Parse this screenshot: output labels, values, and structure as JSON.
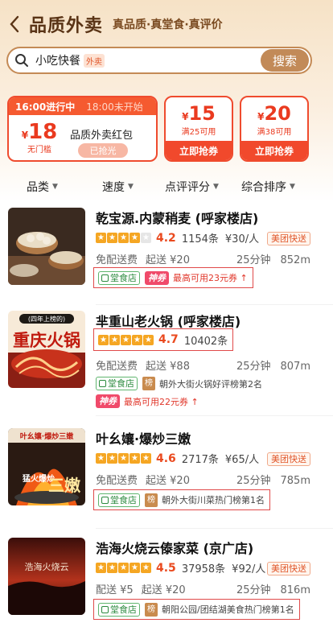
{
  "header": {
    "title": "品质外卖",
    "subtitle": "真品质·真堂食·真评价"
  },
  "search": {
    "query": "小吃快餐",
    "tag": "外卖",
    "button": "搜索"
  },
  "coupons": {
    "main": {
      "now_label": "16:00进行中",
      "next_label": "18:00未开始",
      "currency": "¥",
      "amount": "18",
      "condition": "无门槛",
      "name": "品质外卖红包",
      "button": "已抢光"
    },
    "small": [
      {
        "currency": "¥",
        "amount": "15",
        "condition": "满25可用",
        "button": "立即抢券"
      },
      {
        "currency": "¥",
        "amount": "20",
        "condition": "满38可用",
        "button": "立即抢券"
      }
    ]
  },
  "filters": [
    "品类",
    "速度",
    "点评评分",
    "综合排序"
  ],
  "shops": [
    {
      "name": "乾宝源.内蒙稍麦 (呼家楼店)",
      "stars": 4,
      "rating": "4.2",
      "reviews": "1154条",
      "price": "¥30/人",
      "badge": "美团快送",
      "delivery_fee": "免配送费",
      "min_order": "起送 ¥20",
      "time": "25分钟",
      "distance": "852m",
      "tags": {
        "green": "堂食店",
        "shen": "神券",
        "coupon": "最高可用23元券"
      }
    },
    {
      "name": "芈重山老火锅 (呼家楼店)",
      "stars": 5,
      "rating": "4.7",
      "reviews": "10402条",
      "delivery_fee": "免配送费",
      "min_order": "起送 ¥88",
      "time": "25分钟",
      "distance": "807m",
      "tags": {
        "green": "堂食店",
        "rank_label": "榜",
        "rank": "朝外大街火锅好评榜第2名",
        "shen": "神券",
        "coupon": "最高可用22元券"
      }
    },
    {
      "name": "叶幺孃·爆炒三嫩",
      "stars": 5,
      "rating": "4.6",
      "reviews": "2717条",
      "price": "¥65/人",
      "badge": "美团快送",
      "delivery_fee": "免配送费",
      "min_order": "起送 ¥20",
      "time": "25分钟",
      "distance": "785m",
      "tags": {
        "green": "堂食店",
        "rank_label": "榜",
        "rank": "朝外大街川菜热门榜第1名"
      }
    },
    {
      "name": "浩海火烧云傣家菜 (京广店)",
      "stars": 5,
      "rating": "4.5",
      "reviews": "37958条",
      "price": "¥92/人",
      "badge": "美团快送",
      "delivery_fee": "配送 ¥5",
      "min_order": "起送 ¥20",
      "time": "25分钟",
      "distance": "816m",
      "tags": {
        "green": "堂食店",
        "rank_label": "榜",
        "rank": "朝阳公园/团结湖美食热门榜第1名"
      }
    }
  ],
  "thumb_text": {
    "shop2_banner": "(四年上榜的)",
    "shop2_big": "重庆火锅",
    "shop3_top": "叶幺孃·爆炒三嫩",
    "shop3_side": "猛火爆炒",
    "shop3_big": "三嫩",
    "shop4": "浩海火烧云"
  },
  "colors": {
    "accent": "#ea3a1f",
    "brand_brown": "#c28a58",
    "star": "#f5a623"
  }
}
